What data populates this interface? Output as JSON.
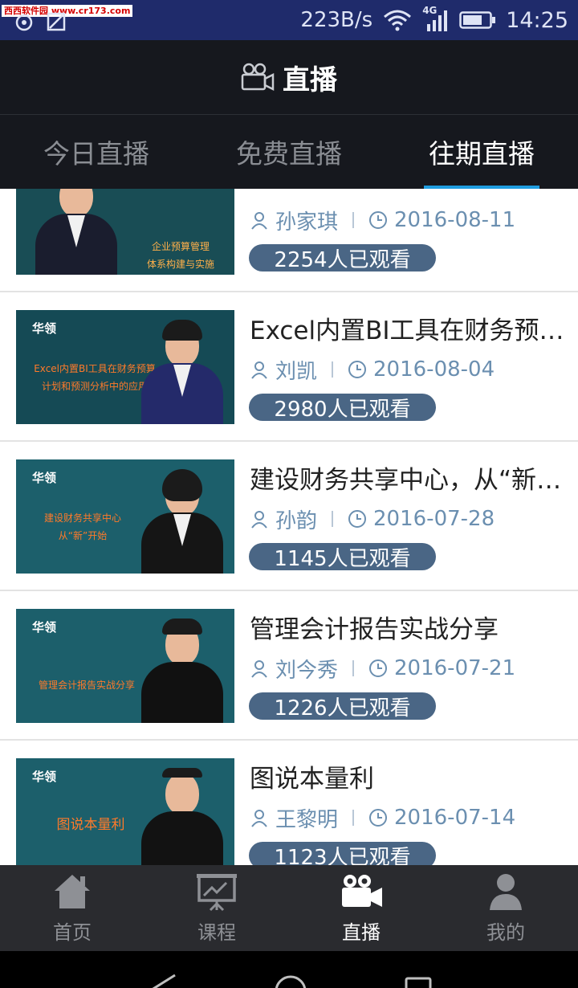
{
  "status_bar": {
    "watermark": "西西软件园 www.cr173.com",
    "net_speed": "223B/s",
    "signal_label": "4G",
    "time": "14:25"
  },
  "header": {
    "title": "直播",
    "icon": "video-camera-icon"
  },
  "tabs": [
    {
      "label": "今日直播",
      "active": false
    },
    {
      "label": "免费直播",
      "active": false
    },
    {
      "label": "往期直播",
      "active": true
    }
  ],
  "lectures": [
    {
      "title": "",
      "thumb_title": "企业预算管理\n体系构建与实施",
      "teacher": "孙家琪",
      "date": "2016-08-11",
      "views": "2254人已观看"
    },
    {
      "title": "Excel内置BI工具在财务预测计划和预测分析中的应用",
      "thumb_brand": "华领",
      "thumb_title": "Excel内置BI工具在财务预算\n计划和预测分析中的应用",
      "teacher": "刘凯",
      "date": "2016-08-04",
      "views": "2980人已观看"
    },
    {
      "title": "建设财务共享中心，从“新”开始",
      "thumb_brand": "华领",
      "thumb_title": "建设财务共享中心\n从“新”开始",
      "teacher": "孙韵",
      "date": "2016-07-28",
      "views": "1145人已观看"
    },
    {
      "title": "管理会计报告实战分享",
      "thumb_brand": "华领",
      "thumb_title": "管理会计报告实战分享",
      "teacher": "刘今秀",
      "date": "2016-07-21",
      "views": "1226人已观看"
    },
    {
      "title": "图说本量利",
      "thumb_brand": "华领",
      "thumb_title": "图说本量利",
      "teacher": "王黎明",
      "date": "2016-07-14",
      "views": "1123人已观看"
    }
  ],
  "bottom_nav": [
    {
      "label": "首页",
      "icon": "home-icon",
      "active": false
    },
    {
      "label": "课程",
      "icon": "presentation-board-icon",
      "active": false
    },
    {
      "label": "直播",
      "icon": "video-camera-icon",
      "active": true
    },
    {
      "label": "我的",
      "icon": "user-icon",
      "active": false
    }
  ],
  "colors": {
    "status_bar_bg": "#1f2b6b",
    "header_bg": "#16181e",
    "tab_indicator": "#1f9de0",
    "views_badge": "#4a6685",
    "meta_text": "#6b8fb0",
    "bottom_nav_bg": "#2a2b2f"
  }
}
